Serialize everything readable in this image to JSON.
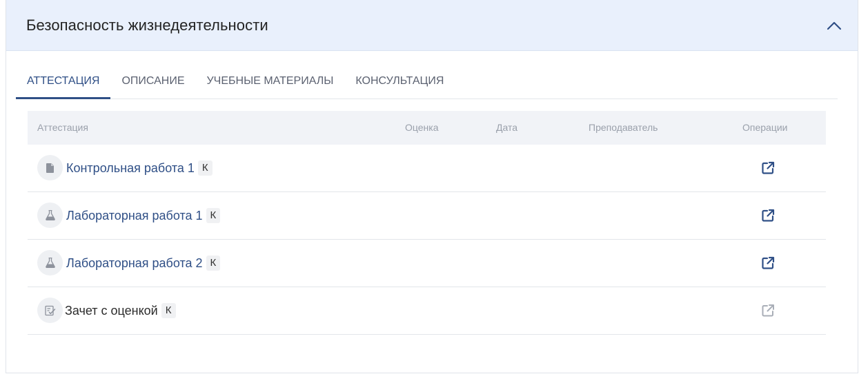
{
  "header": {
    "title": "Безопасность жизнедеятельности",
    "collapse_icon": "chevron-up-icon"
  },
  "tabs": [
    {
      "label": "АТТЕСТАЦИЯ",
      "active": true
    },
    {
      "label": "ОПИСАНИЕ",
      "active": false
    },
    {
      "label": "УЧЕБНЫЕ МАТЕРИАЛЫ",
      "active": false
    },
    {
      "label": "КОНСУЛЬТАЦИЯ",
      "active": false
    }
  ],
  "table": {
    "columns": [
      "Аттестация",
      "Оценка",
      "Дата",
      "Преподаватель",
      "Операции"
    ],
    "rows": [
      {
        "icon": "document-icon",
        "title": "Контрольная работа 1",
        "badge": "К",
        "link": true,
        "grade": "",
        "date": "",
        "teacher": "",
        "op_enabled": true
      },
      {
        "icon": "flask-icon",
        "title": "Лабораторная работа 1",
        "badge": "К",
        "link": true,
        "grade": "",
        "date": "",
        "teacher": "",
        "op_enabled": true
      },
      {
        "icon": "flask-icon",
        "title": "Лабораторная работа 2",
        "badge": "К",
        "link": true,
        "grade": "",
        "date": "",
        "teacher": "",
        "op_enabled": true
      },
      {
        "icon": "checklist-icon",
        "title": "Зачет с оценкой",
        "badge": "К",
        "link": false,
        "grade": "",
        "date": "",
        "teacher": "",
        "op_enabled": false
      }
    ]
  },
  "colors": {
    "accent": "#2f4f86",
    "header_bg": "#e9f0fc",
    "table_head_bg": "#f1f3f7",
    "disabled_icon": "#a9aeb7"
  }
}
